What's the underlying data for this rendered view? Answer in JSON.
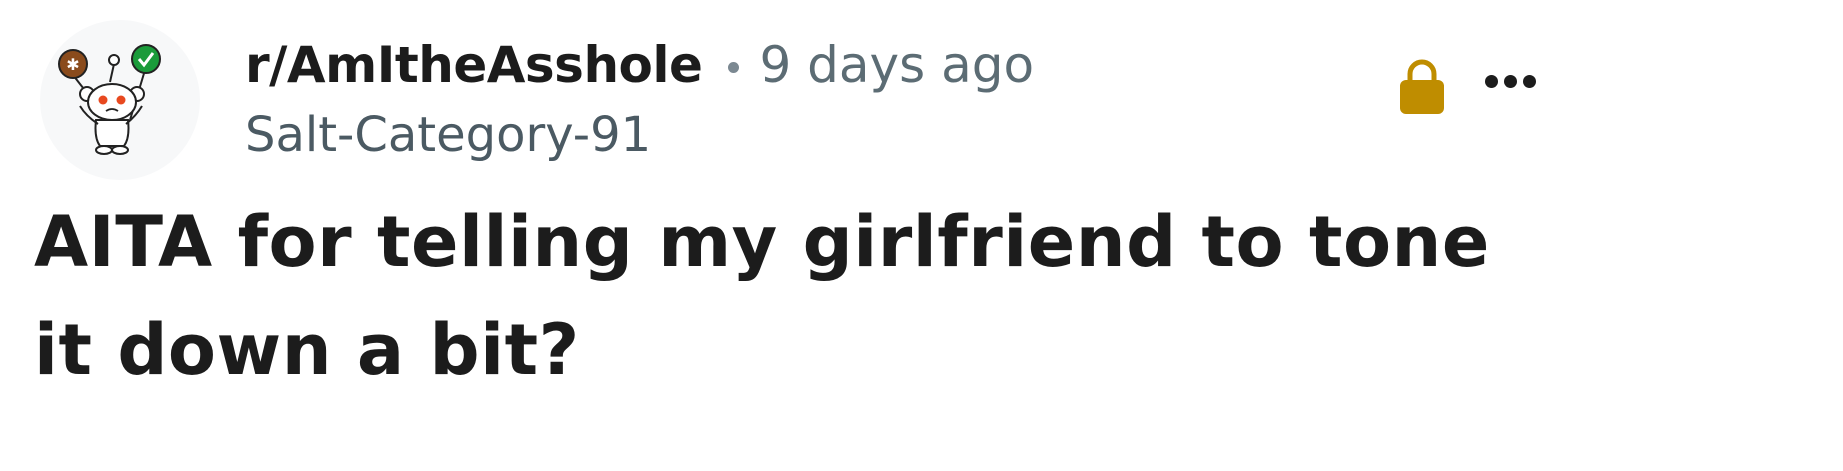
{
  "post": {
    "subreddit": "r/AmItheAsshole",
    "separator": "•",
    "time_ago": "9 days ago",
    "author": "Salt-Category-91",
    "title": "AITA for telling my girlfriend to tone it down a bit?"
  },
  "icons": {
    "avatar": "snoo-balloons-avatar",
    "lock": "lock-icon",
    "more": "more-options-icon"
  },
  "colors": {
    "text_primary": "#1c1c1c",
    "text_secondary": "#5c6c74",
    "lock_gold": "#bf8d00",
    "balloon_green": "#1a9b3a",
    "balloon_brown": "#8a4b1c",
    "snoo_eyes": "#e8491f"
  }
}
